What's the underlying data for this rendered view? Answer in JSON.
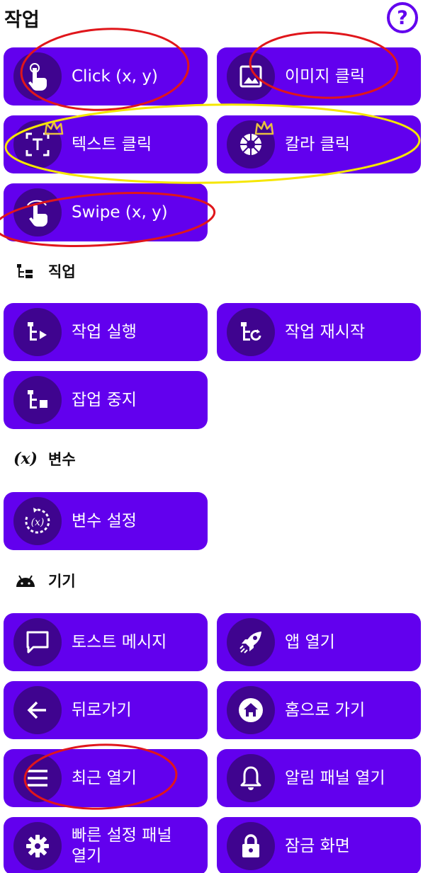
{
  "header": {
    "title": "작업",
    "help_icon": "help-circle-icon",
    "help_glyph": "?"
  },
  "sections": {
    "tasks": {
      "title": "작업"
    },
    "jobs": {
      "title": "직업"
    },
    "variables": {
      "title": "변수",
      "icon_text": "(x)"
    },
    "device": {
      "title": "기기"
    }
  },
  "buttons": {
    "click_xy": "Click (x, y)",
    "image_click": "이미지 클릭",
    "text_click": "텍스트 클릭",
    "color_click": "칼라 클릭",
    "swipe_xy": "Swipe (x, y)",
    "run_job": "작업 실행",
    "restart_job": "작업 재시작",
    "stop_job": "잡업 중지",
    "set_variable": "변수 설정",
    "toast_message": "토스트 메시지",
    "open_app": "앱 열기",
    "go_back": "뒤로가기",
    "go_home": "홈으로 가기",
    "open_recents": "최근 열기",
    "open_notifications": "알림 패널 열기",
    "quick_settings": "빠른 설정 패널 열기",
    "lock_screen": "잠금 화면"
  },
  "colors": {
    "accent": "#6200ee",
    "icon_circle": "#3f048f",
    "annotation_red": "#e0161b",
    "annotation_yellow": "#f5e600",
    "crown": "#e8c040"
  }
}
